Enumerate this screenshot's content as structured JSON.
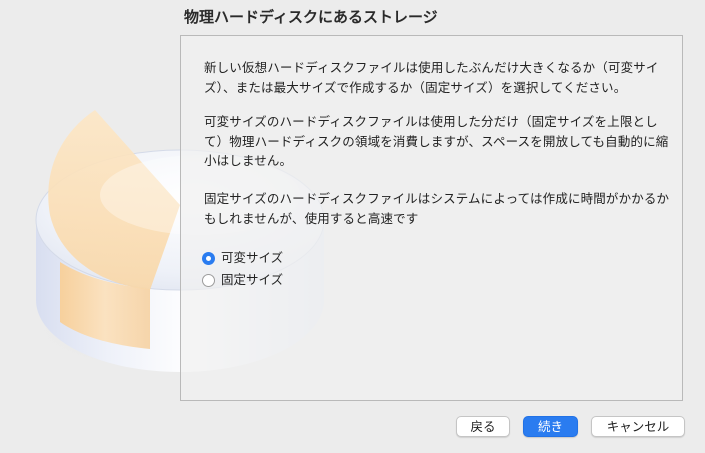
{
  "page": {
    "title": "物理ハードディスクにあるストレージ"
  },
  "content": {
    "paragraphs": [
      "新しい仮想ハードディスクファイルは使用したぶんだけ大きくなるか（可変サイズ）、または最大サイズで作成するか（固定サイズ）を選択してください。",
      "可変サイズのハードディスクファイルは使用した分だけ（固定サイズを上限として）物理ハードディスクの領域を消費しますが、スペースを開放しても自動的に縮小はしません。",
      "固定サイズのハードディスクファイルはシステムによっては作成に時間がかかるかもしれませんが、使用すると高速です"
    ],
    "options": [
      {
        "label": "可変サイズ",
        "selected": true
      },
      {
        "label": "固定サイズ",
        "selected": false
      }
    ]
  },
  "buttons": {
    "back_label": "戻る",
    "next_label": "続き",
    "cancel_label": "キャンセル"
  },
  "colors": {
    "accent": "#2a7cf0",
    "window_background": "#ececec"
  },
  "icons": {
    "illustration": "hard-disk-pie-illustration"
  }
}
